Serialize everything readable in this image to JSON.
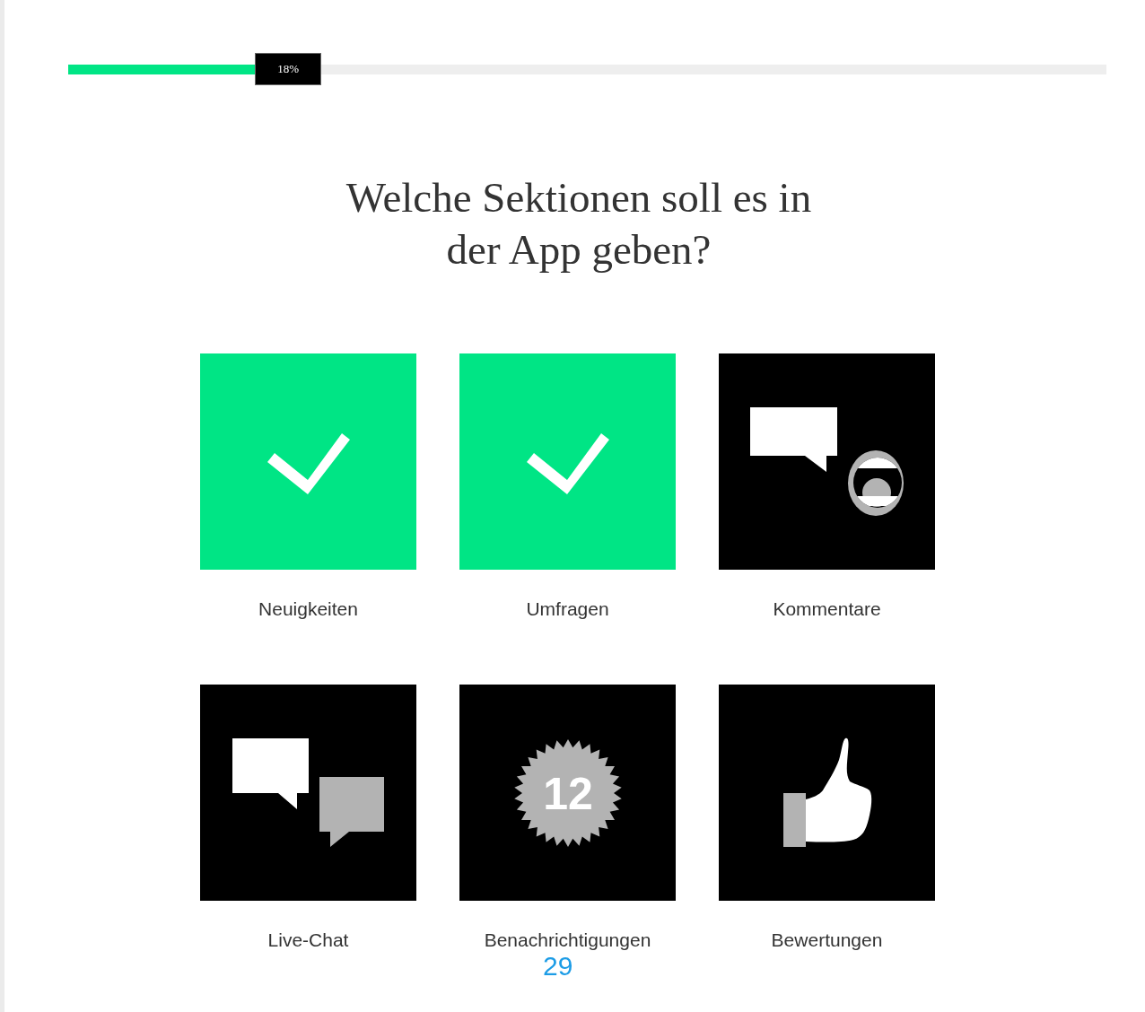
{
  "progress": {
    "level": 0.18,
    "reading": "18%"
  },
  "title": "Welche Sektionen soll es in der App geben?",
  "options": [
    {
      "label": "Neuigkeiten",
      "selected": true
    },
    {
      "label": "Umfragen",
      "selected": true
    },
    {
      "label": "Kommentare",
      "selected": false,
      "kind": "comments"
    },
    {
      "label": "Live-Chat",
      "selected": false,
      "kind": "chat"
    },
    {
      "label": "Benachrichtigungen",
      "selected": false,
      "kind": "notifications",
      "badge": "12"
    },
    {
      "label": "Bewertungen",
      "selected": false,
      "kind": "ratings"
    }
  ],
  "overlay_number": "29"
}
